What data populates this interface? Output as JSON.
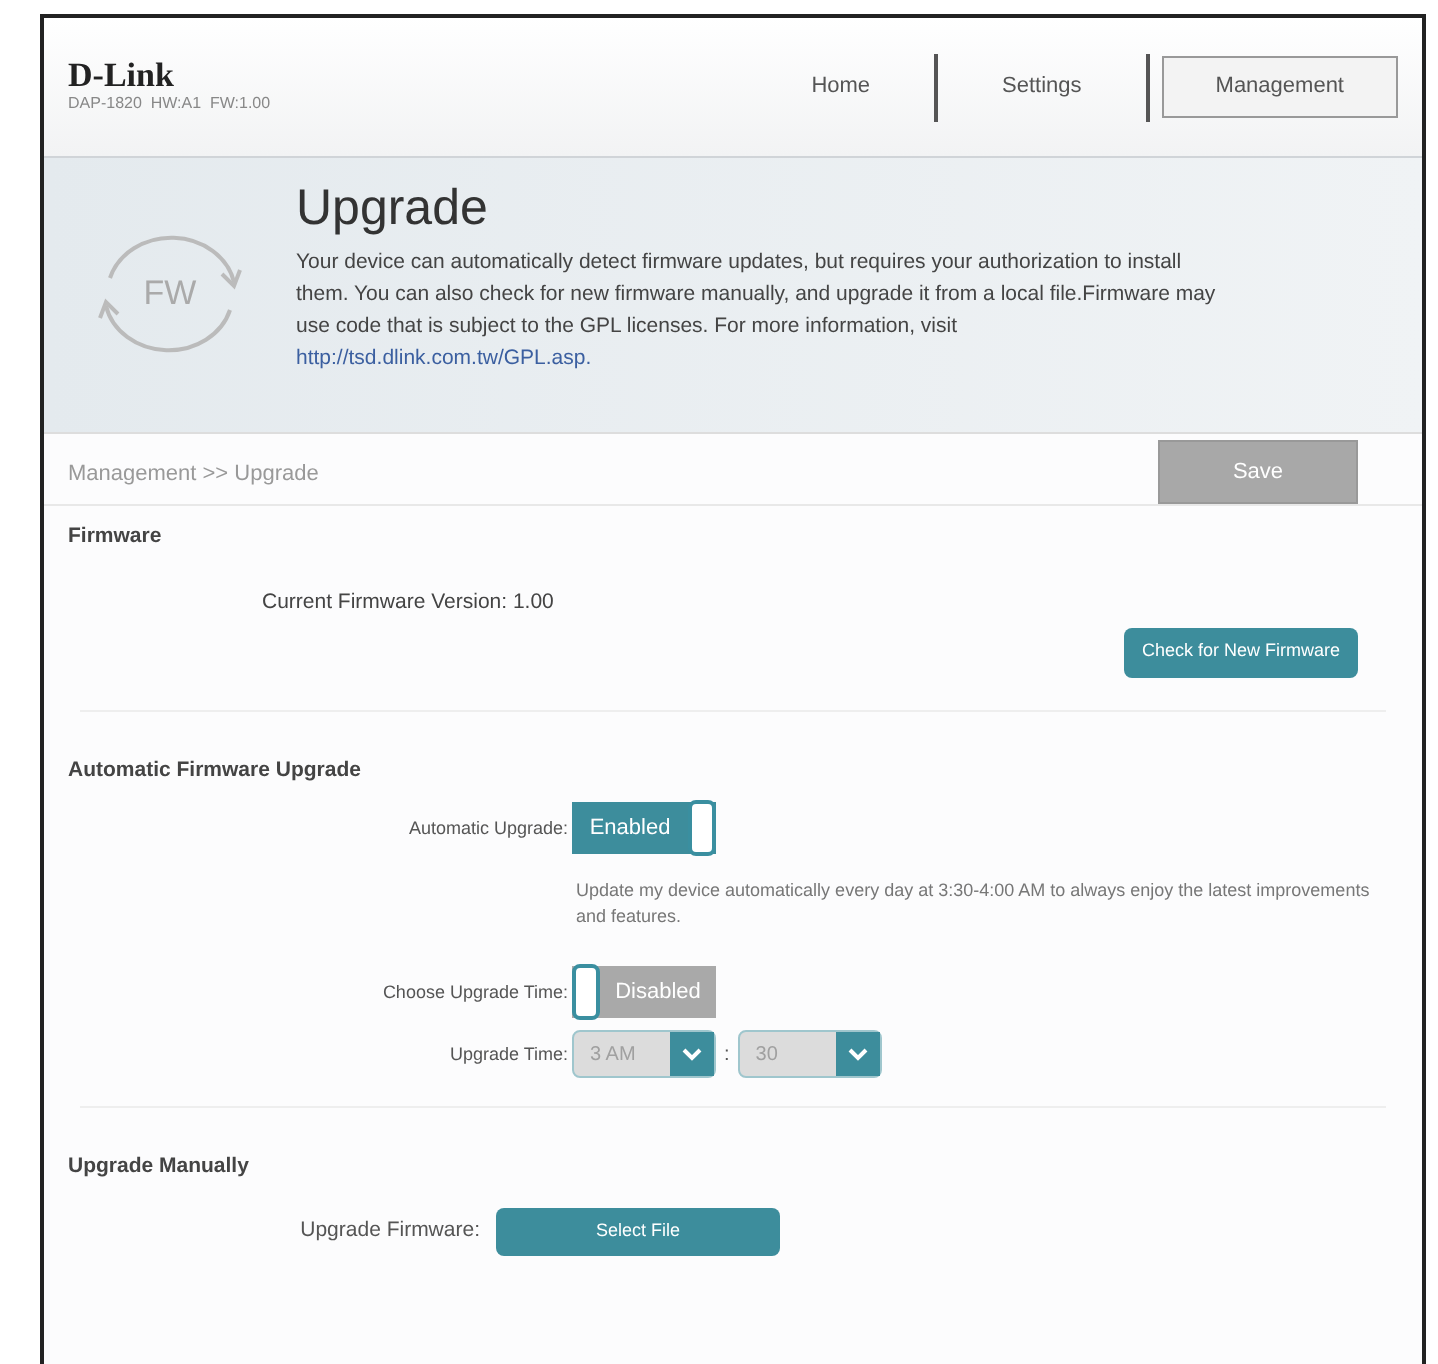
{
  "header": {
    "logo": "D-Link",
    "device_info": "DAP-1820  HW:A1  FW:1.00",
    "nav": [
      {
        "label": "Home",
        "selected": false
      },
      {
        "label": "Settings",
        "selected": false
      },
      {
        "label": "Management",
        "selected": true
      }
    ]
  },
  "banner": {
    "icon_label": "FW",
    "title": "Upgrade",
    "description": "Your device can automatically detect firmware updates, but requires your authorization to install them. You can also check for new firmware manually, and upgrade it from a local file.Firmware may use code that is subject to the GPL licenses. For more information, visit",
    "link": "http://tsd.dlink.com.tw/GPL.asp."
  },
  "breadcrumb": "Management >> Upgrade",
  "save_button": {
    "label": "Save",
    "disabled": true
  },
  "firmware": {
    "heading": "Firmware",
    "current_version": "Current Firmware Version: 1.00",
    "check_button": "Check for New Firmware"
  },
  "automatic": {
    "heading": "Automatic Firmware Upgrade",
    "auto_upgrade": {
      "label": "Automatic Upgrade:",
      "state_text": "Enabled",
      "on": true
    },
    "note": "Update my device automatically every day at 3:30-4:00 AM to always enjoy the latest improvements and features.",
    "choose_time": {
      "label": "Choose Upgrade Time:",
      "state_text": "Disabled",
      "on": false
    },
    "upgrade_time": {
      "label": "Upgrade Time:",
      "hour": "3 AM",
      "separator": ":",
      "minute": "30"
    }
  },
  "manual": {
    "heading": "Upgrade Manually",
    "label": "Upgrade Firmware:",
    "button": "Select File"
  }
}
